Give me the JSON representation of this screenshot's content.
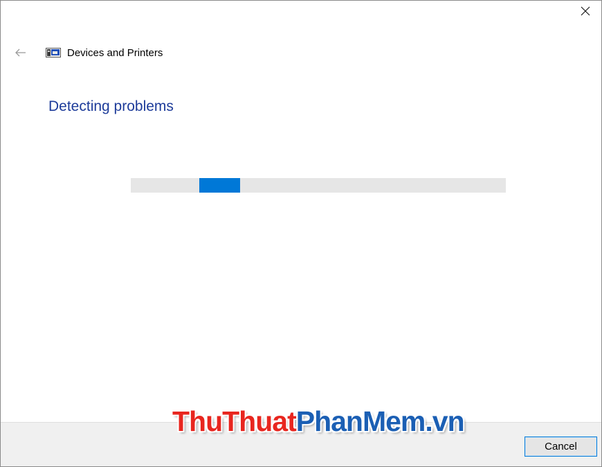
{
  "window": {
    "breadcrumb": "Devices and Printers",
    "close_icon": "close-icon",
    "back_icon": "back-arrow-icon",
    "app_icon": "devices-and-printers-icon"
  },
  "main": {
    "title": "Detecting problems",
    "title_color": "#1e3c9a",
    "progress": {
      "state": "indeterminate",
      "fill_color": "#0078d7",
      "track_color": "#e6e6e6"
    }
  },
  "footer": {
    "cancel_label": "Cancel"
  },
  "watermark": {
    "part1": "ThuThuat",
    "part2": "PhanMem",
    "part3": ".vn",
    "red": "#e8261f",
    "blue": "#1b5fb4"
  }
}
